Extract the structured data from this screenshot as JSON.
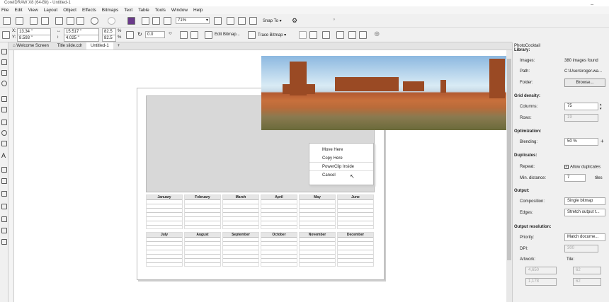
{
  "window": {
    "title": "CorelDRAW X8 (64-Bit) - Untitled-1",
    "minimize_label": "_"
  },
  "menu": [
    "File",
    "Edit",
    "View",
    "Layout",
    "Object",
    "Effects",
    "Bitmaps",
    "Text",
    "Table",
    "Tools",
    "Window",
    "Help"
  ],
  "toolbar": {
    "zoom": "71%",
    "snap_to": "Snap To"
  },
  "property_bar": {
    "x": "13.34 \"",
    "y": "8.593 \"",
    "w": "15.517 \"",
    "h": "4.025 \"",
    "sx": "82.5",
    "sy": "82.5",
    "pct": "%",
    "rotation": "0.0",
    "edit_bitmap": "Edit Bitmap...",
    "trace_bitmap": "Trace Bitmap"
  },
  "tabs": [
    "Welcome Screen",
    "Title slide.cdr",
    "Untitled-1"
  ],
  "calendar": {
    "months_row1": [
      "January",
      "February",
      "March",
      "April",
      "May",
      "June"
    ],
    "months_row2": [
      "July",
      "August",
      "September",
      "October",
      "November",
      "December"
    ]
  },
  "context_menu": [
    "Move Here",
    "Copy Here",
    "PowerClip Inside",
    "Cancel"
  ],
  "docker": {
    "title": "PhotoCocktail",
    "library_label": "Library:",
    "images_label": "Images:",
    "images_value": "380 images found",
    "path_label": "Path:",
    "path_value": "C:\\Users\\roger.wa...",
    "folder_label": "Folder:",
    "browse_button": "Browse...",
    "grid_density": "Grid density:",
    "columns_label": "Columns:",
    "columns_value": "75",
    "rows_label": "Rows:",
    "rows_value": "19",
    "optimization": "Optimization:",
    "blending_label": "Blending:",
    "blending_value": "50 %",
    "duplicates": "Duplicates:",
    "repeat_label": "Repeat:",
    "allow_duplicates": "Allow duplicates",
    "min_distance_label": "Min. distance:",
    "min_distance_value": "7",
    "tiles": "tiles",
    "output": "Output:",
    "composition_label": "Composition:",
    "composition_value": "Single bitmap",
    "edges_label": "Edges:",
    "edges_value": "Stretch output t...",
    "output_resolution": "Output resolution:",
    "priority_label": "Priority:",
    "priority_value": "Match docume...",
    "dpi_label": "DPI:",
    "dpi_value": "300",
    "artwork_label": "Artwork:",
    "tile_label": "Tile:",
    "art_w": "4,650",
    "art_h": "1,178",
    "tile_w": "62",
    "tile_h": "62"
  }
}
